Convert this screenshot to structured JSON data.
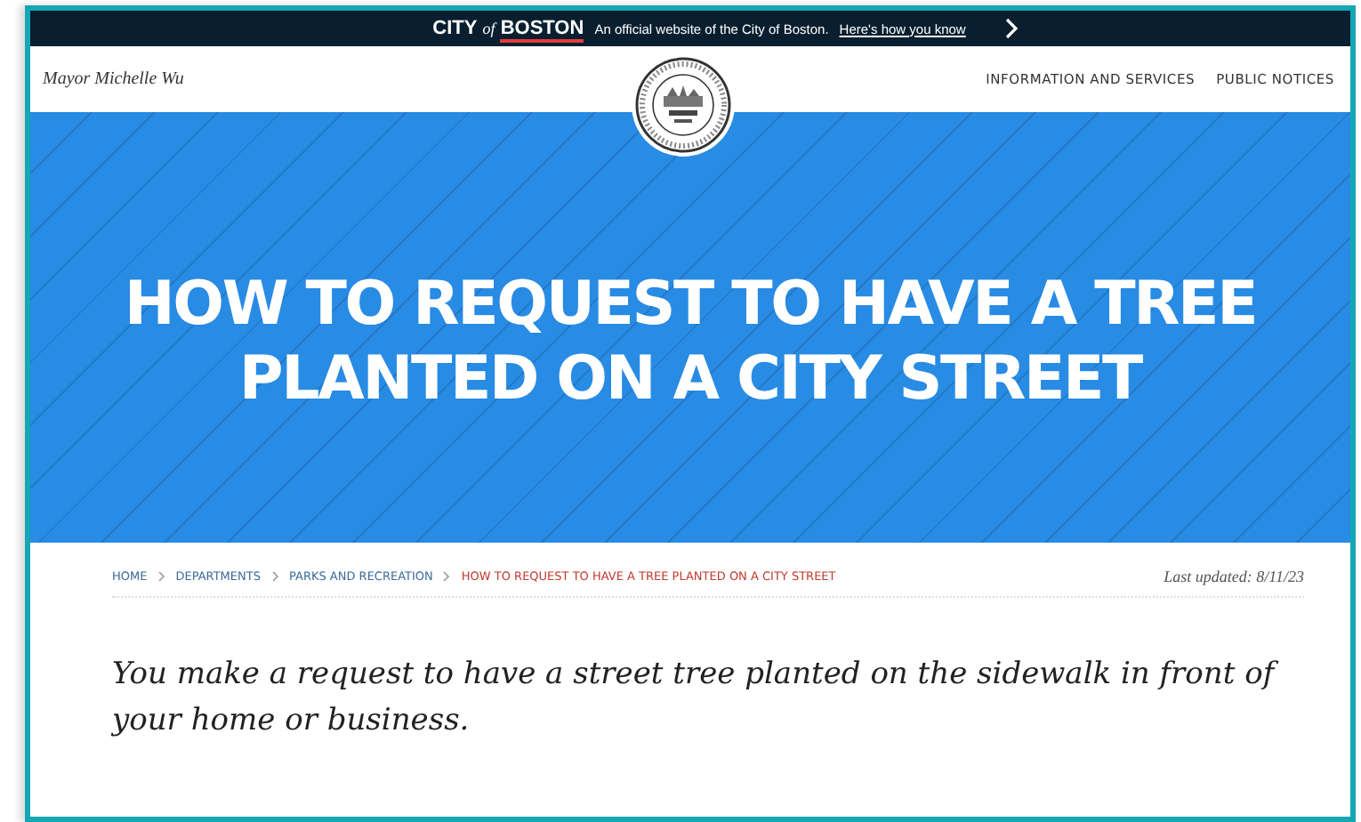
{
  "official_banner": {
    "logo": {
      "city": "CITY",
      "of": "of",
      "boston": "BOSTON"
    },
    "text": "An official website of the City of Boston.",
    "link": "Here's how you know"
  },
  "header": {
    "mayor": "Mayor Michelle Wu",
    "nav": [
      "INFORMATION AND SERVICES",
      "PUBLIC NOTICES"
    ]
  },
  "hero": {
    "title": "HOW TO REQUEST TO HAVE A TREE PLANTED ON A CITY STREET"
  },
  "breadcrumb": [
    {
      "label": "HOME",
      "selected": false
    },
    {
      "label": "DEPARTMENTS",
      "selected": false
    },
    {
      "label": "PARKS AND RECREATION",
      "selected": false
    },
    {
      "label": "HOW TO REQUEST TO HAVE A TREE PLANTED ON A CITY STREET",
      "selected": true
    }
  ],
  "last_updated": "Last updated: 8/11/23",
  "intro": "You make a request to have a street tree planted on the sidewalk in front of your home or business."
}
